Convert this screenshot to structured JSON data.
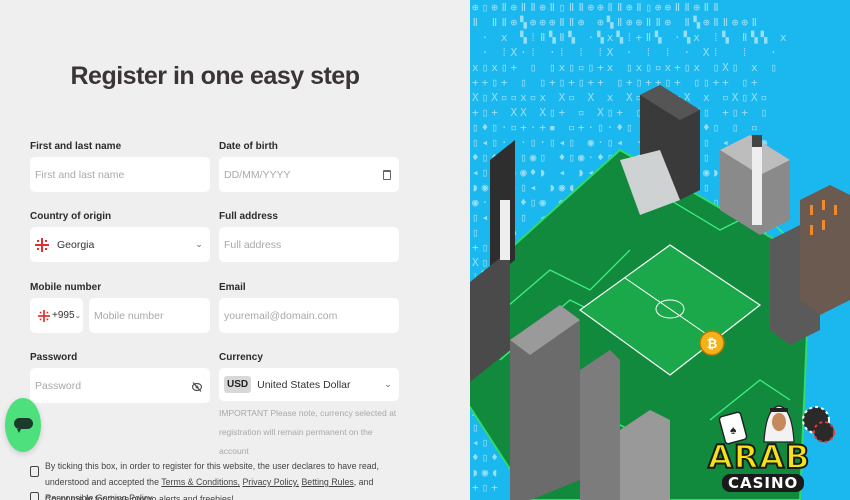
{
  "form": {
    "title": "Register in one easy step",
    "fields": {
      "name": {
        "label": "First and last name",
        "placeholder": "First and last name"
      },
      "dob": {
        "label": "Date of birth",
        "placeholder": "DD/MM/YYYY",
        "icon": "calendar-icon"
      },
      "country": {
        "label": "Country of origin",
        "value": "Georgia",
        "icon": "georgia-flag"
      },
      "address": {
        "label": "Full address",
        "placeholder": "Full address"
      },
      "mobile": {
        "label": "Mobile number",
        "code": "+995",
        "placeholder": "Mobile number"
      },
      "email": {
        "label": "Email",
        "placeholder": "youremail@domain.com"
      },
      "password": {
        "label": "Password",
        "placeholder": "Password",
        "icon": "eye-off-icon"
      },
      "currency": {
        "label": "Currency",
        "code": "USD",
        "value": "United States Dollar"
      }
    },
    "currency_note": "IMPORTANT Please note, currency selected at registration will remain permanent on the account",
    "terms": {
      "text_before": "By ticking this box, in order to register for this website, the user declares to have read, understood and accepted the",
      "links": [
        "Terms & Conditions,",
        "Privacy Policy,",
        "Betting Rules"
      ],
      "and": ", and",
      "last_link": "Responsible Gaming Policy."
    },
    "promo": "Count me in for those promo alerts and freebies!"
  },
  "chat": {
    "icon": "chat-bubble-icon"
  },
  "brand": {
    "logo_top": "ARAB",
    "logo_bottom": "CASINO"
  },
  "colors": {
    "accent_green": "#4de07c",
    "panel_blue": "#1ab8ee",
    "logo_yellow": "#f5e21a"
  }
}
